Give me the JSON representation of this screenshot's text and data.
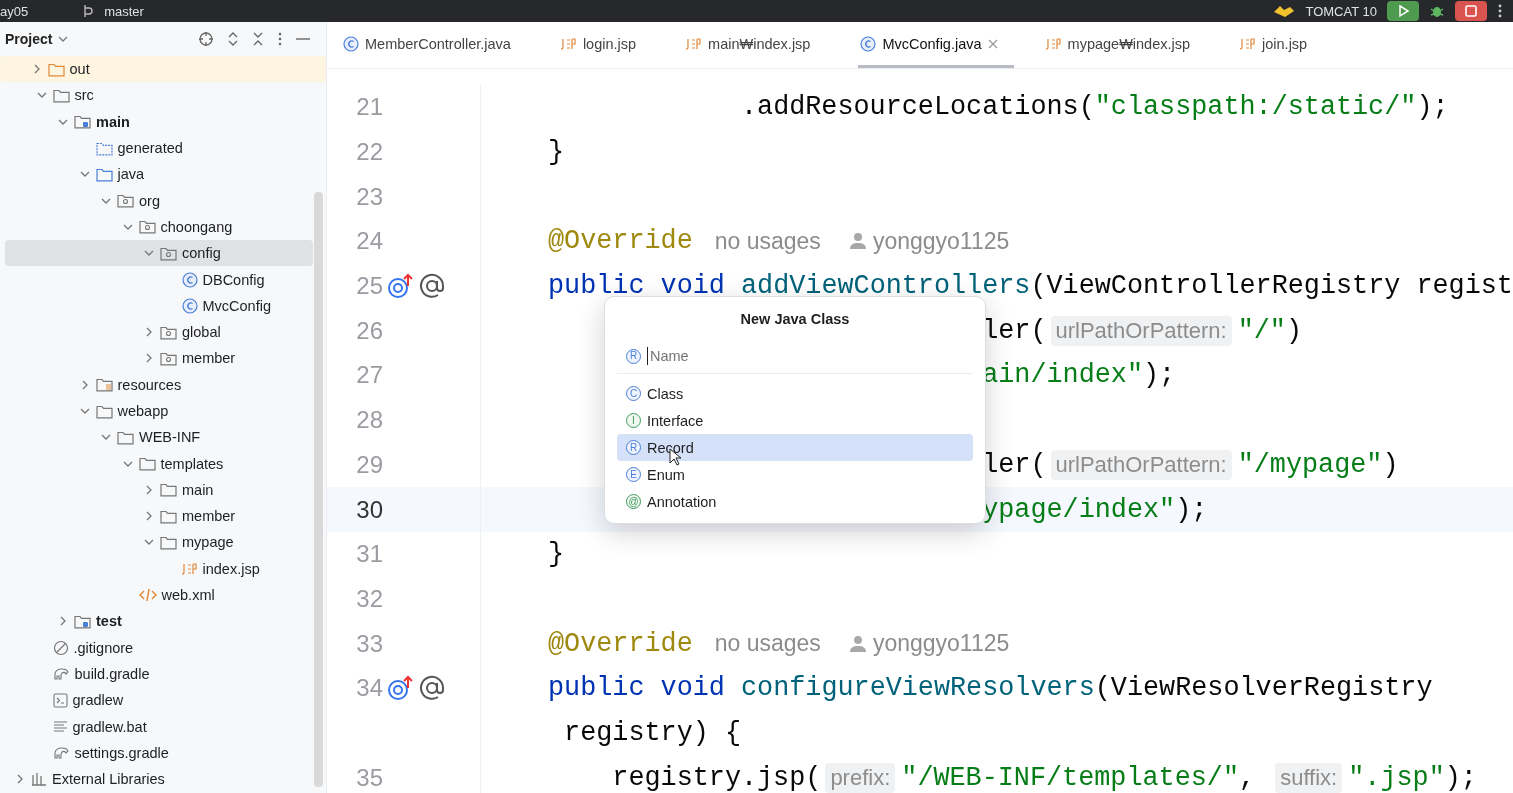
{
  "topbar": {
    "project": "ay05",
    "branch": "master",
    "run_config": "TOMCAT 10"
  },
  "sidebar": {
    "title": "Project",
    "tree": [
      {
        "label": "out",
        "kind": "excluded",
        "expanded": false,
        "selected": false
      },
      {
        "label": "src",
        "kind": "folder",
        "expanded": true,
        "selected": false,
        "children": [
          {
            "label": "main",
            "kind": "module",
            "expanded": true,
            "selected": false,
            "children": [
              {
                "label": "generated",
                "kind": "generated",
                "selected": false
              },
              {
                "label": "java",
                "kind": "sources",
                "expanded": true,
                "selected": false,
                "children": [
                  {
                    "label": "org",
                    "kind": "package",
                    "expanded": true,
                    "selected": false,
                    "children": [
                      {
                        "label": "choongang",
                        "kind": "package",
                        "expanded": true,
                        "selected": false,
                        "children": [
                          {
                            "label": "config",
                            "kind": "package",
                            "expanded": true,
                            "selected": true,
                            "children": [
                              {
                                "label": "DBConfig",
                                "kind": "class",
                                "selected": false
                              },
                              {
                                "label": "MvcConfig",
                                "kind": "class",
                                "selected": false
                              }
                            ]
                          },
                          {
                            "label": "global",
                            "kind": "package",
                            "expanded": false,
                            "selected": false
                          },
                          {
                            "label": "member",
                            "kind": "package",
                            "expanded": false,
                            "selected": false
                          }
                        ]
                      }
                    ]
                  }
                ]
              },
              {
                "label": "resources",
                "kind": "resources",
                "expanded": false,
                "selected": false
              },
              {
                "label": "webapp",
                "kind": "folder",
                "expanded": true,
                "selected": false,
                "children": [
                  {
                    "label": "WEB-INF",
                    "kind": "folder",
                    "expanded": true,
                    "selected": false,
                    "children": [
                      {
                        "label": "templates",
                        "kind": "folder",
                        "expanded": true,
                        "selected": false,
                        "children": [
                          {
                            "label": "main",
                            "kind": "folder",
                            "expanded": false,
                            "selected": false
                          },
                          {
                            "label": "member",
                            "kind": "folder",
                            "expanded": false,
                            "selected": false
                          },
                          {
                            "label": "mypage",
                            "kind": "folder",
                            "expanded": true,
                            "selected": false,
                            "children": [
                              {
                                "label": "index.jsp",
                                "kind": "jsp",
                                "selected": false
                              }
                            ]
                          }
                        ]
                      },
                      {
                        "label": "web.xml",
                        "kind": "xml",
                        "selected": false
                      }
                    ]
                  }
                ]
              }
            ]
          },
          {
            "label": "test",
            "kind": "module",
            "expanded": false,
            "selected": false
          }
        ]
      },
      {
        "label": ".gitignore",
        "kind": "ignore",
        "selected": false
      },
      {
        "label": "build.gradle",
        "kind": "gradle",
        "selected": false
      },
      {
        "label": "gradlew",
        "kind": "terminal",
        "selected": false
      },
      {
        "label": "gradlew.bat",
        "kind": "text",
        "selected": false
      },
      {
        "label": "settings.gradle",
        "kind": "gradle",
        "selected": false
      }
    ],
    "footer_item": {
      "label": "External Libraries",
      "kind": "library",
      "expanded": false
    }
  },
  "tabs": [
    {
      "label": "MemberController.java",
      "kind": "class",
      "selected": false
    },
    {
      "label": "login.jsp",
      "kind": "jsp",
      "selected": false
    },
    {
      "label": "main₩index.jsp",
      "kind": "jsp",
      "selected": false
    },
    {
      "label": "MvcConfig.java",
      "kind": "class",
      "selected": true
    },
    {
      "label": "mypage₩index.jsp",
      "kind": "jsp",
      "selected": false
    },
    {
      "label": "join.jsp",
      "kind": "jsp",
      "selected": false
    }
  ],
  "editor": {
    "lines": [
      {
        "number": "21",
        "current": false,
        "overrides": false,
        "segments": [
          {
            "kind": "plain",
            "text": "            .addResourceLocations("
          },
          {
            "kind": "str",
            "text": "\"classpath:/static/\""
          },
          {
            "kind": "plain",
            "text": ");"
          }
        ]
      },
      {
        "number": "22",
        "current": false,
        "overrides": false,
        "segments": [
          {
            "kind": "plain",
            "text": "}"
          }
        ]
      },
      {
        "number": "23",
        "current": false,
        "overrides": false
      },
      {
        "number": "24",
        "current": false,
        "overrides": false,
        "segments": [
          {
            "kind": "ann",
            "text": "@Override"
          },
          {
            "kind": "usage",
            "text": "no usages"
          },
          {
            "kind": "author",
            "text": "yonggyo1125"
          }
        ]
      },
      {
        "number": "25",
        "current": false,
        "overrides": true,
        "segments": [
          {
            "kind": "kw",
            "text": "public void "
          },
          {
            "kind": "fn",
            "text": "addViewControllers"
          },
          {
            "kind": "plain",
            "text": "(ViewControllerRegistry regist"
          }
        ]
      },
      {
        "number": "26",
        "current": false,
        "overrides": false,
        "segments": [
          {
            "kind": "plain",
            "text": "                           ler("
          },
          {
            "kind": "hint",
            "text": "urlPathOrPattern:"
          },
          {
            "kind": "str",
            "text": "\"/\""
          },
          {
            "kind": "plain",
            "text": ")"
          }
        ]
      },
      {
        "number": "27",
        "current": false,
        "overrides": false,
        "segments": [
          {
            "kind": "str",
            "text": "                           ain/index\""
          },
          {
            "kind": "plain",
            "text": ");"
          }
        ]
      },
      {
        "number": "28",
        "current": false,
        "overrides": false
      },
      {
        "number": "29",
        "current": false,
        "overrides": false,
        "segments": [
          {
            "kind": "plain",
            "text": "                           ler("
          },
          {
            "kind": "hint",
            "text": "urlPathOrPattern:"
          },
          {
            "kind": "str",
            "text": "\"/mypage\""
          },
          {
            "kind": "plain",
            "text": ")"
          }
        ]
      },
      {
        "number": "30",
        "current": true,
        "overrides": false,
        "segments": [
          {
            "kind": "str",
            "text": "                           ypage/index\""
          },
          {
            "kind": "plain",
            "text": ");"
          }
        ]
      },
      {
        "number": "31",
        "current": false,
        "overrides": false,
        "segments": [
          {
            "kind": "plain",
            "text": "}"
          }
        ]
      },
      {
        "number": "32",
        "current": false,
        "overrides": false
      },
      {
        "number": "33",
        "current": false,
        "overrides": false,
        "segments": [
          {
            "kind": "ann",
            "text": "@Override"
          },
          {
            "kind": "usage",
            "text": "no usages"
          },
          {
            "kind": "author",
            "text": "yonggyo1125"
          }
        ]
      },
      {
        "number": "34",
        "current": false,
        "overrides": true,
        "segments": [
          {
            "kind": "kw",
            "text": "public void "
          },
          {
            "kind": "fn",
            "text": "configureViewResolvers"
          },
          {
            "kind": "plain",
            "text": "(ViewResolverRegistry"
          }
        ],
        "wrap": [
          {
            "kind": "plain",
            "text": " registry) {"
          }
        ]
      },
      {
        "number": "35",
        "current": false,
        "overrides": false,
        "segments": [
          {
            "kind": "plain",
            "text": "    registry.jsp("
          },
          {
            "kind": "hint",
            "text": "prefix:"
          },
          {
            "kind": "str",
            "text": "\"/WEB-INF/templates/\""
          },
          {
            "kind": "plain",
            "text": ", "
          },
          {
            "kind": "hint",
            "text": "suffix:"
          },
          {
            "kind": "str",
            "text": "\".jsp\""
          },
          {
            "kind": "plain",
            "text": ");"
          }
        ]
      }
    ]
  },
  "popup": {
    "title": "New Java Class",
    "field": {
      "icon": "R",
      "placeholder": "Name"
    },
    "items": [
      {
        "label": "Class",
        "icon": "C",
        "kind": "class",
        "selected": false
      },
      {
        "label": "Interface",
        "icon": "I",
        "kind": "interface",
        "selected": false
      },
      {
        "label": "Record",
        "icon": "R",
        "kind": "record",
        "selected": true
      },
      {
        "label": "Enum",
        "icon": "E",
        "kind": "enum",
        "selected": false
      },
      {
        "label": "Annotation",
        "icon": "@",
        "kind": "annotation",
        "selected": false
      }
    ]
  }
}
